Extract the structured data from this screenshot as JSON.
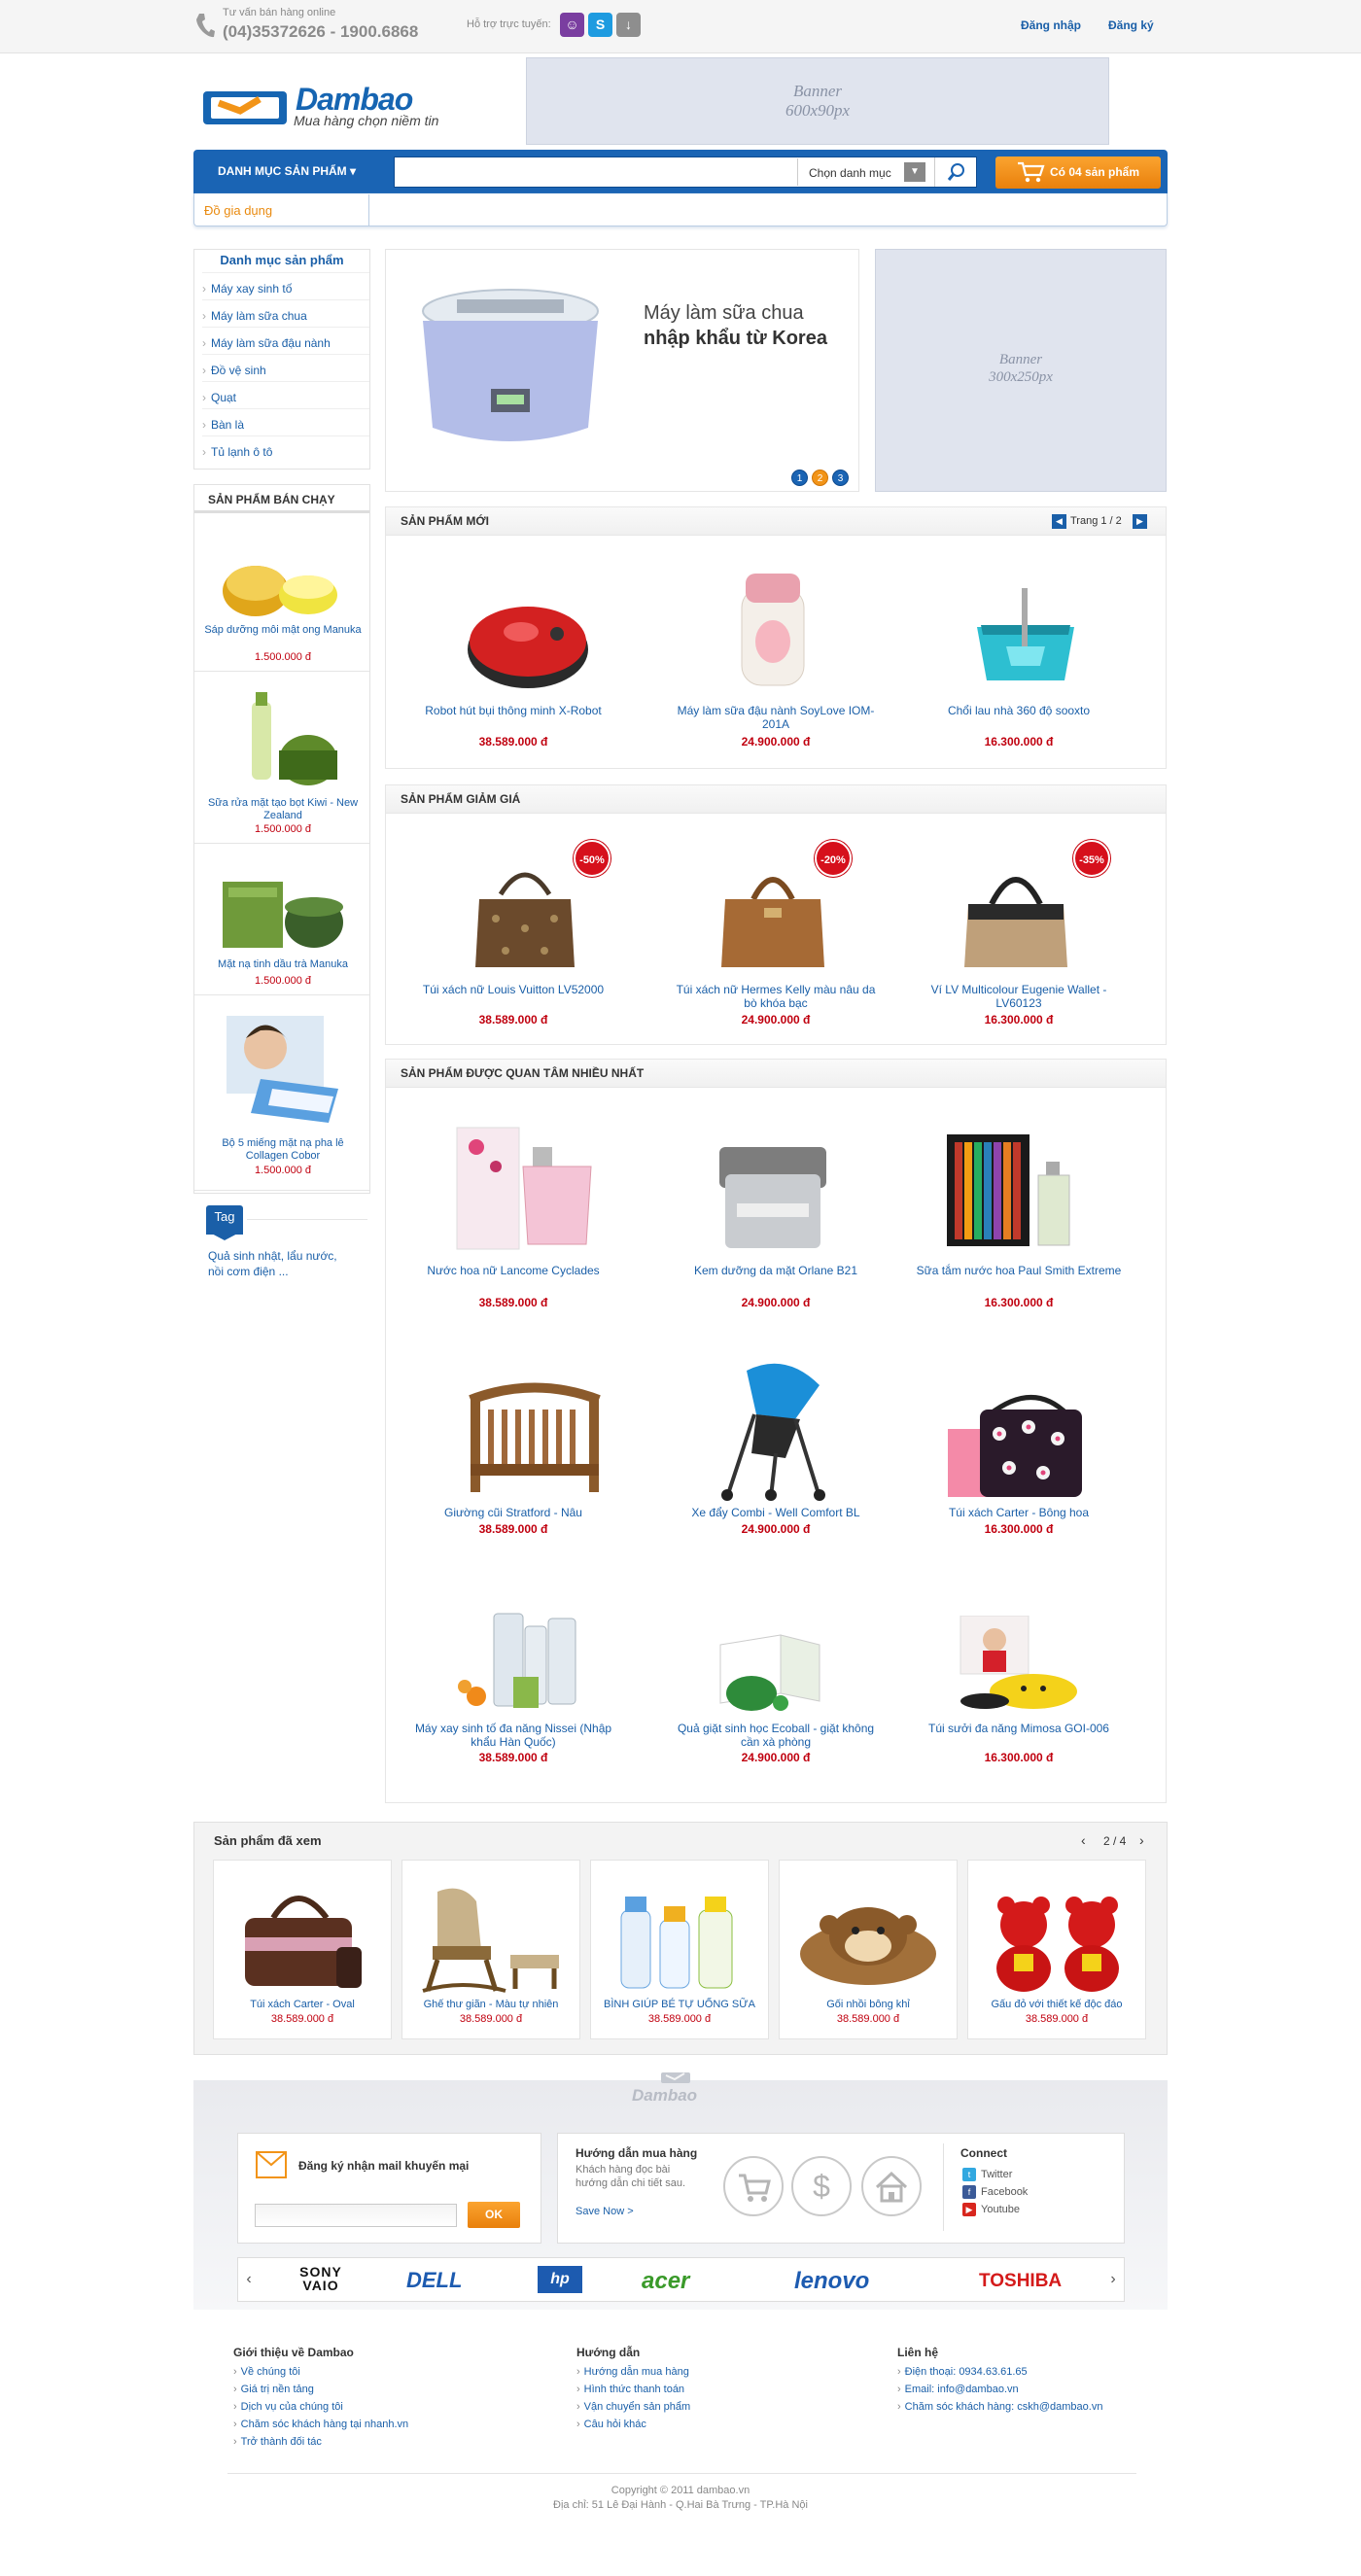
{
  "topbar": {
    "hotline_label": "Tư vấn bán hàng online",
    "hotline_number": "(04)35372626 - 1900.6868",
    "support_label": "Hỗ trợ trực tuyến:",
    "login": "Đăng nhập",
    "register": "Đăng ký"
  },
  "header": {
    "logo_text": "Dambao",
    "slogan": "Mua hàng chọn niềm tin",
    "banner_line1": "Banner",
    "banner_line2": "600x90px"
  },
  "nav": {
    "category_button": "DANH MỤC SẢN PHẨM",
    "search_value": "",
    "category_select": "Chọn danh mục",
    "cart_label": "Có 04 sản phẩm",
    "sub_link": "Đồ gia dụng"
  },
  "sidebar": {
    "category_title": "Danh mục sản phẩm",
    "categories": [
      "Máy xay sinh tố",
      "Máy làm sữa chua",
      "Máy làm sữa đậu nành",
      "Đồ vệ sinh",
      "Quạt",
      "Bàn là",
      "Tủ lạnh ô tô"
    ],
    "bestseller_title": "SẢN PHẨM BÁN CHẠY",
    "bestsellers": [
      {
        "name": "Sáp dưỡng môi mật ong Manuka",
        "price": "1.500.000 đ"
      },
      {
        "name": "Sữa rửa mặt tạo bọt Kiwi - New Zealand",
        "price": "1.500.000 đ"
      },
      {
        "name": "Mặt nạ tinh dầu trà Manuka",
        "price": "1.500.000 đ"
      },
      {
        "name": "Bộ 5 miếng mặt nạ pha lê Collagen Cobor",
        "price": "1.500.000 đ"
      }
    ],
    "tag_label": "Tag",
    "tag_text": "Quả sinh nhật, lẩu nước, nồi cơm điện ..."
  },
  "slider": {
    "line1": "Máy làm sữa chua",
    "line2": "nhập khẩu từ Korea",
    "dots": [
      "1",
      "2",
      "3"
    ],
    "active_dot": 1
  },
  "side_banner": {
    "line1": "Banner",
    "line2": "300x250px"
  },
  "new_products": {
    "title": "SẢN PHẨM MỚI",
    "page": "Trang 1 / 2",
    "items": [
      {
        "name": "Robot hút bụi thông minh X-Robot",
        "price": "38.589.000 đ"
      },
      {
        "name": "Máy làm sữa đậu nành SoyLove IOM-201A",
        "price": "24.900.000 đ"
      },
      {
        "name": "Chổi lau nhà 360 độ sooxto",
        "price": "16.300.000 đ"
      }
    ]
  },
  "sale_products": {
    "title": "SẢN PHẨM GIẢM GIÁ",
    "items": [
      {
        "name": "Túi xách nữ Louis Vuitton LV52000",
        "price": "38.589.000 đ",
        "discount": "-50%"
      },
      {
        "name": "Túi xách nữ Hermes Kelly màu nâu da bò khóa bạc",
        "price": "24.900.000 đ",
        "discount": "-20%"
      },
      {
        "name": "Ví LV Multicolour Eugenie Wallet - LV60123",
        "price": "16.300.000 đ",
        "discount": "-35%"
      }
    ]
  },
  "popular_products": {
    "title": "SẢN PHẨM ĐƯỢC QUAN TÂM NHIỀU NHẤT",
    "items": [
      {
        "name": "Nước hoa nữ Lancome Cyclades",
        "price": "38.589.000 đ"
      },
      {
        "name": "Kem dưỡng da mặt Orlane B21",
        "price": "24.900.000 đ"
      },
      {
        "name": "Sữa tắm nước hoa Paul Smith Extreme",
        "price": "16.300.000 đ"
      },
      {
        "name": "Giường cũi Stratford - Nâu",
        "price": "38.589.000 đ"
      },
      {
        "name": "Xe đẩy Combi - Well Comfort BL",
        "price": "24.900.000 đ"
      },
      {
        "name": "Túi xách Carter - Bông hoa",
        "price": "16.300.000 đ"
      },
      {
        "name": "Máy xay sinh tố đa năng Nissei (Nhập khẩu Hàn Quốc)",
        "price": "38.589.000 đ"
      },
      {
        "name": "Quả giặt sinh học Ecoball - giặt không cần xà phòng",
        "price": "24.900.000 đ"
      },
      {
        "name": "Túi sưởi đa năng Mimosa GOI-006",
        "price": "16.300.000 đ"
      }
    ]
  },
  "viewed": {
    "title": "Sản phẩm đã xem",
    "page": "2 / 4",
    "items": [
      {
        "name": "Túi xách Carter - Oval",
        "price": "38.589.000 đ"
      },
      {
        "name": "Ghế thư giãn - Màu tự nhiên",
        "price": "38.589.000 đ"
      },
      {
        "name": "BÌNH GIÚP BÉ TỰ UỐNG SỮA",
        "price": "38.589.000 đ"
      },
      {
        "name": "Gối nhồi bông khỉ",
        "price": "38.589.000 đ"
      },
      {
        "name": "Gấu đỏ với thiết kế độc đáo",
        "price": "38.589.000 đ"
      }
    ]
  },
  "footer": {
    "logo_text": "Dambao",
    "newsletter_title": "Đăng ký nhận mail khuyến mại",
    "newsletter_value": "",
    "newsletter_button": "OK",
    "guide_title": "Hướng dẫn mua hàng",
    "guide_desc": "Khách hàng đọc bài hướng dẫn chi tiết sau.",
    "guide_more": "Save Now >",
    "connect_title": "Connect",
    "social": [
      "Twitter",
      "Facebook",
      "Youtube"
    ],
    "brands": [
      "SONY VAIO",
      "DELL",
      "hp",
      "acer",
      "lenovo",
      "TOSHIBA"
    ],
    "col1_title": "Giới thiệu về Dambao",
    "col1_items": [
      "Về chúng tôi",
      "Giá trị nền tảng",
      "Dịch vụ của chúng tôi",
      "Chăm sóc khách hàng tại nhanh.vn",
      "Trở thành đối tác"
    ],
    "col2_title": "Hướng dẫn",
    "col2_items": [
      "Hướng dẫn mua hàng",
      "Hình thức thanh toán",
      "Vận chuyển sản phẩm",
      "Câu hỏi khác"
    ],
    "col3_title": "Liên hệ",
    "col3_items": [
      "Điện thoại: 0934.63.61.65",
      "Email: info@dambao.vn",
      "Chăm sóc khách hàng: cskh@dambao.vn"
    ],
    "copyright": "Copyright © 2011 dambao.vn",
    "address": "Địa chỉ: 51 Lê Đại Hành - Q.Hai Bà Trưng - TP.Hà Nội"
  },
  "colors": {
    "brand_blue": "#1a64b4",
    "accent_orange": "#f29418",
    "price_red": "#c0000f",
    "link_blue": "#1a5fa8"
  }
}
